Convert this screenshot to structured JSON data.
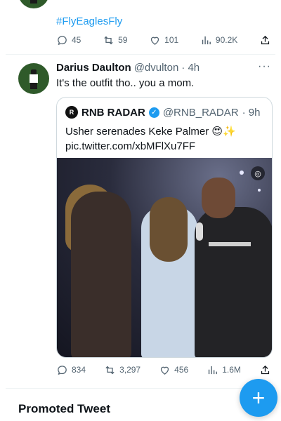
{
  "prev_tweet": {
    "hashtag": "#FlyEaglesFly",
    "stats": {
      "replies": "45",
      "retweets": "59",
      "likes": "101",
      "views": "90.2K"
    }
  },
  "tweet": {
    "name": "Darius Daulton",
    "handle": "@dvulton",
    "time": "· 4h",
    "more": "···",
    "text": "It's the outfit tho.. you a mom.",
    "quote": {
      "logo": "R",
      "name": "RNB RADAR",
      "handle": "@RNB_RADAR",
      "time": "· 9h",
      "text": "Usher serenades Keke Palmer 😍✨ pic.twitter.com/xbMFlXu7FF"
    },
    "stats": {
      "replies": "834",
      "retweets": "3,297",
      "likes": "456",
      "views": "1.6M"
    }
  },
  "promoted_label": "Promoted Tweet",
  "fab_label": "+",
  "colors": {
    "accent": "#1d9bf0",
    "secondary_text": "#536471",
    "divider": "#eff3f4"
  },
  "icons": [
    "reply-icon",
    "retweet-icon",
    "like-icon",
    "views-icon",
    "share-icon",
    "verified-icon",
    "more-icon",
    "compose-icon"
  ]
}
